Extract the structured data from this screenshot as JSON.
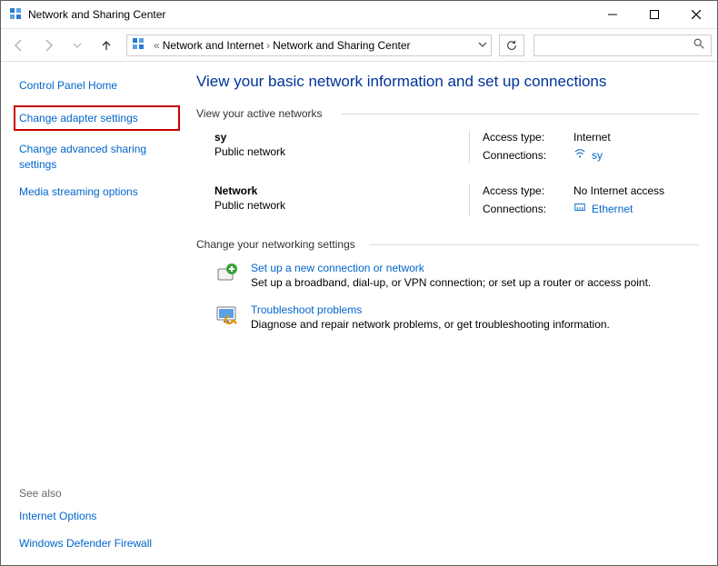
{
  "window": {
    "title": "Network and Sharing Center"
  },
  "breadcrumb": {
    "sep_glyphs": {
      "dbl_left": "«",
      "chev": "›"
    },
    "level1": "Network and Internet",
    "level2": "Network and Sharing Center"
  },
  "search": {
    "placeholder": ""
  },
  "sidebar": {
    "home": "Control Panel Home",
    "adapter": "Change adapter settings",
    "advanced": "Change advanced sharing settings",
    "media": "Media streaming options",
    "seealso_heading": "See also",
    "seealso": {
      "internet_options": "Internet Options",
      "firewall": "Windows Defender Firewall"
    }
  },
  "main": {
    "title": "View your basic network information and set up connections",
    "active_heading": "View your active networks",
    "settings_heading": "Change your networking settings",
    "labels": {
      "access_type": "Access type:",
      "connections": "Connections:"
    },
    "networks": [
      {
        "name": "sy",
        "type": "Public network",
        "access": "Internet",
        "connection": "sy"
      },
      {
        "name": "Network",
        "type": "Public network",
        "access": "No Internet access",
        "connection": "Ethernet"
      }
    ],
    "settings_items": [
      {
        "title": "Set up a new connection or network",
        "desc": "Set up a broadband, dial-up, or VPN connection; or set up a router or access point."
      },
      {
        "title": "Troubleshoot problems",
        "desc": "Diagnose and repair network problems, or get troubleshooting information."
      }
    ]
  }
}
